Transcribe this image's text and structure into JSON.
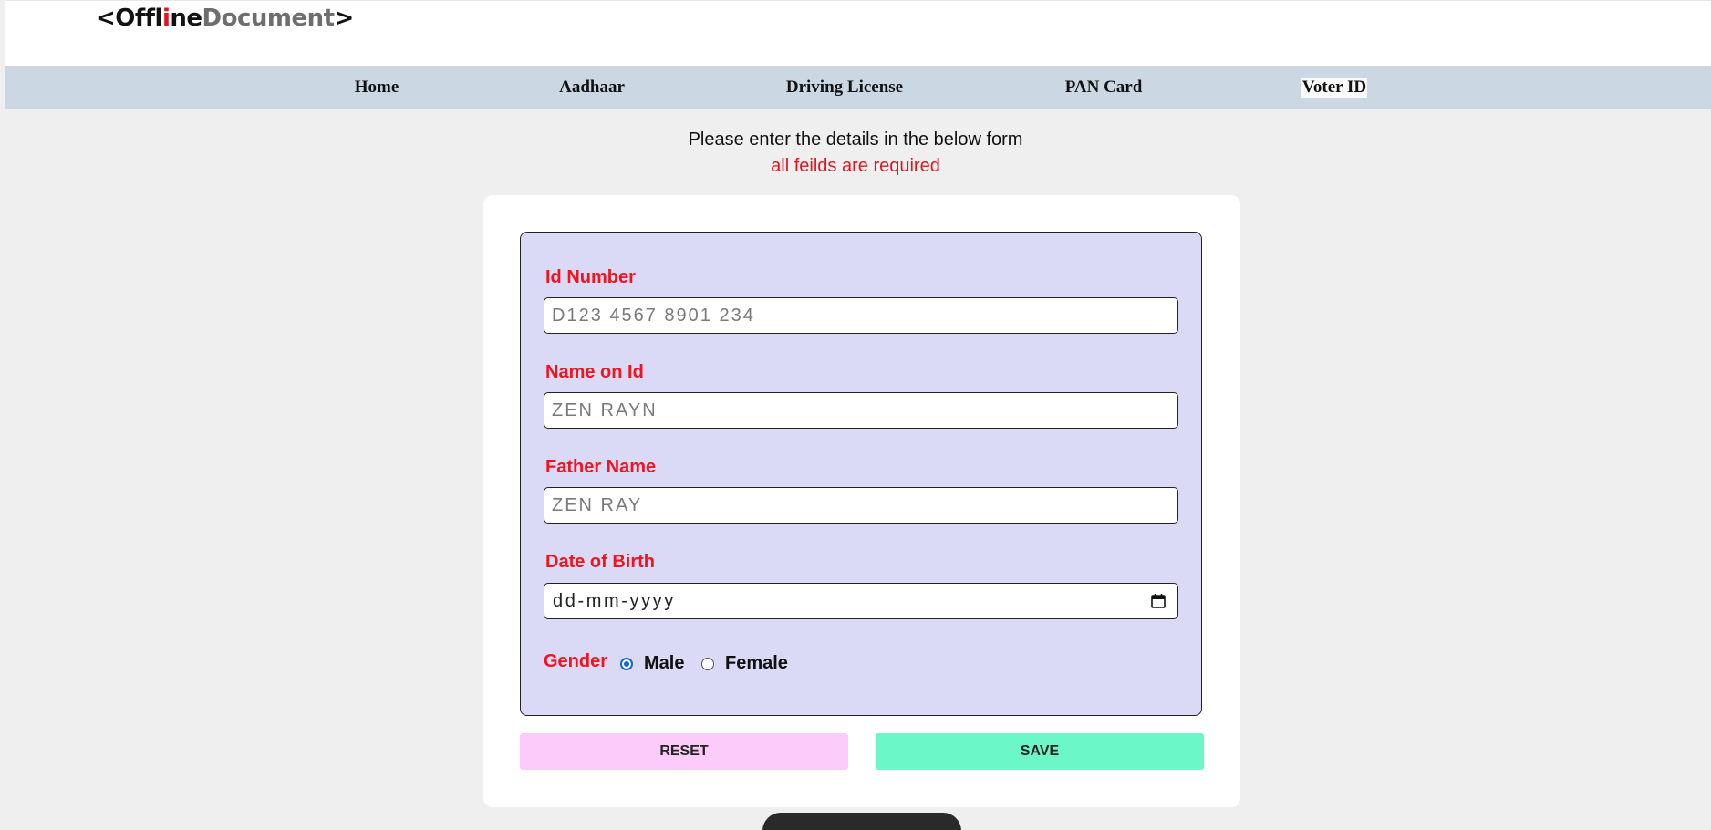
{
  "logo": {
    "open": "<",
    "part1": "Offl",
    "part2": "i",
    "part3": "ne",
    "part4": "Document",
    "close": ">"
  },
  "nav": {
    "items": [
      {
        "label": "Home"
      },
      {
        "label": "Aadhaar"
      },
      {
        "label": "Driving License"
      },
      {
        "label": "PAN Card"
      },
      {
        "label": "Voter ID"
      }
    ]
  },
  "intro": {
    "text": "Please enter the details in the below form",
    "required_note": "all feilds are required"
  },
  "form": {
    "id_number": {
      "label": "Id Number",
      "placeholder": "D123 4567 8901 234"
    },
    "name": {
      "label": "Name on Id",
      "placeholder": "ZEN RAYN"
    },
    "father": {
      "label": "Father Name",
      "placeholder": "ZEN RAY"
    },
    "dob": {
      "label": "Date of Birth",
      "placeholder": "dd-mm-yyyy"
    },
    "gender": {
      "label": "Gender",
      "options": [
        {
          "label": "Male",
          "selected": true
        },
        {
          "label": "Female",
          "selected": false
        }
      ]
    }
  },
  "buttons": {
    "reset": "RESET",
    "save": "SAVE"
  },
  "colors": {
    "accent_red": "#f0141e",
    "nav_bg": "#cbd8e3",
    "form_bg": "#dadaf7",
    "reset_bg": "#fdcbfa",
    "save_bg": "#6cf7c9",
    "radio_selected": "#1565d8"
  }
}
